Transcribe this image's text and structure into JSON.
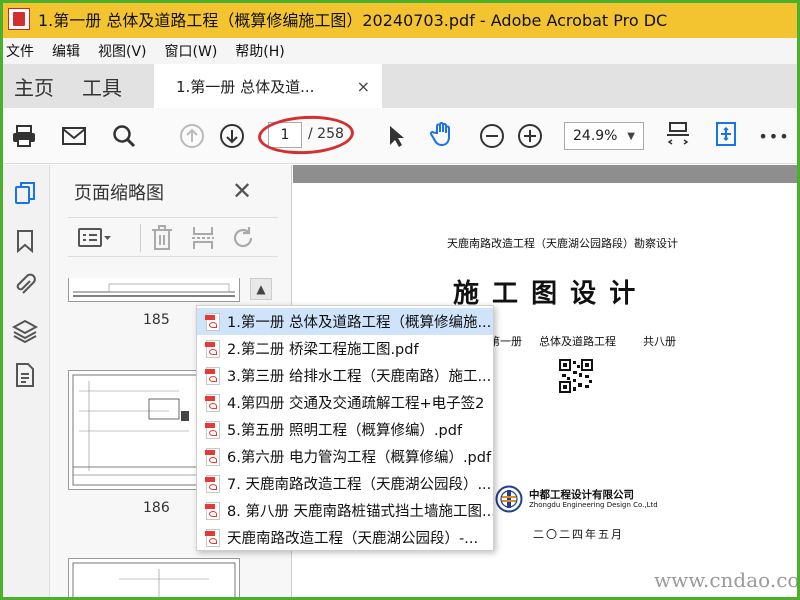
{
  "window": {
    "title": "1.第一册 总体及道路工程（概算修编施工图）20240703.pdf - Adobe Acrobat Pro DC"
  },
  "menu": [
    "文件",
    "编辑",
    "视图(V)",
    "窗口(W)",
    "帮助(H)"
  ],
  "tabs": {
    "home": "主页",
    "tools": "工具",
    "document": "1.第一册 总体及道...",
    "close": "×"
  },
  "toolbar": {
    "page_current": "1",
    "page_total": "/ 258",
    "zoom": "24.9%",
    "more": "•••"
  },
  "thumbnails_panel": {
    "title": "页面缩略图",
    "close": "✕",
    "pages": [
      "185",
      "186"
    ]
  },
  "pdf_page": {
    "header": "天鹿南路改造工程（天鹿湖公园路段）勘察设计",
    "big_title": "施  工  图  设  计",
    "volume": "第一册",
    "volume_name": "总体及道路工程",
    "volume_count": "共八册",
    "company_cn": "中都工程设计有限公司",
    "company_en": "Zhongdu Engineering Design Co.,Ltd",
    "date": "二〇二四年五月"
  },
  "dropdown": {
    "items": [
      "1.第一册 总体及道路工程（概算修编施...",
      "2.第二册 桥梁工程施工图.pdf",
      "3.第三册 给排水工程（天鹿南路）施工...",
      "4.第四册 交通及交通疏解工程+电子签2",
      "5.第五册 照明工程（概算修编）.pdf",
      "6.第六册 电力管沟工程（概算修编）.pdf",
      "7. 天鹿南路改造工程（天鹿湖公园段）...",
      "8. 第八册 天鹿南路桩锚式挡土墙施工图...",
      "天鹿南路改造工程（天鹿湖公园段）-..."
    ],
    "selected_index": 0
  },
  "watermark": "www.cndao.com",
  "colors": {
    "titlebar": "#f4c430",
    "frame": "#4caf2e",
    "annotation": "#d32f2f",
    "accent": "#1a73e8"
  }
}
